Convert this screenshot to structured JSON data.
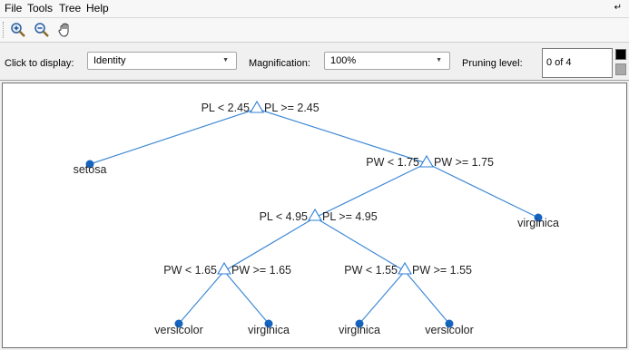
{
  "menu": {
    "items": [
      "File",
      "Tools",
      "Tree",
      "Help"
    ]
  },
  "toolbar": {
    "tools": [
      "zoom-in-icon",
      "zoom-out-icon",
      "pan-hand-icon"
    ]
  },
  "controls": {
    "display_label": "Click to display:",
    "display_value": "Identity",
    "magnification_label": "Magnification:",
    "magnification_value": "100%",
    "pruning_label": "Pruning level:",
    "pruning_value": "0 of 4"
  },
  "colors": {
    "tree_line": "#3f8ad6",
    "leaf_fill": "#1565c0",
    "node_stroke": "#2f7fd4"
  },
  "tree": {
    "root_left": "PL < 2.45",
    "root_right": "PL >= 2.45",
    "leaf_setosa": "setosa",
    "n2_left": "PW < 1.75",
    "n2_right": "PW >= 1.75",
    "leaf_virginica_top": "virginica",
    "n3_left": "PL < 4.95",
    "n3_right": "PL >= 4.95",
    "n4_left": "PW < 1.65",
    "n4_right": "PW >= 1.65",
    "n5_left": "PW < 1.55",
    "n5_right": "PW >= 1.55",
    "leaf_1": "versicolor",
    "leaf_2": "virginica",
    "leaf_3": "virginica",
    "leaf_4": "versicolor"
  }
}
